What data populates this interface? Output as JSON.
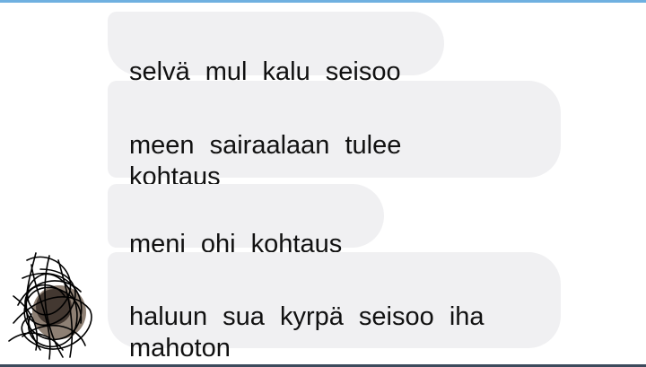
{
  "conversation": {
    "messages": [
      {
        "text": "selvä mul kalu seisoo"
      },
      {
        "text": "meen sairaalaan tulee\nkohtaus"
      },
      {
        "text": "meni ohi kohtaus"
      },
      {
        "text": "haluun sua kyrpä seisoo iha\nmahoton"
      }
    ]
  },
  "colors": {
    "bubble_background": "#f0f0f2",
    "text": "#111111",
    "top_accent": "#6fb0e0",
    "bottom_bar": "#3c4a5c"
  },
  "icons": {
    "avatar": "scribbled-out-avatar"
  }
}
